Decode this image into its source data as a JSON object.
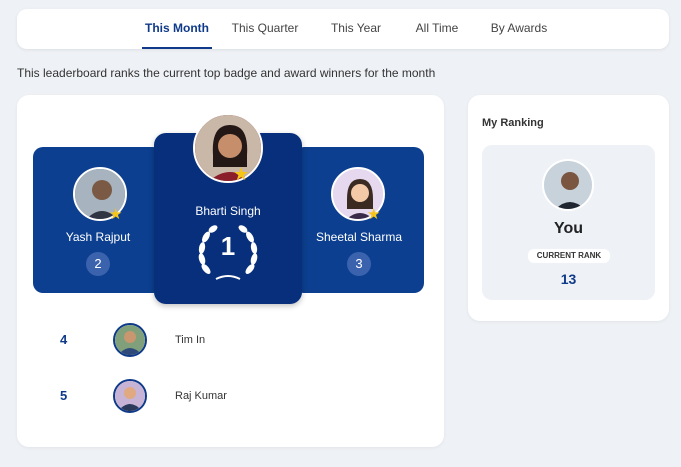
{
  "tabs": [
    {
      "label": "This Month",
      "active": true
    },
    {
      "label": "This Quarter",
      "active": false
    },
    {
      "label": "This Year",
      "active": false
    },
    {
      "label": "All Time",
      "active": false
    },
    {
      "label": "By Awards",
      "active": false
    }
  ],
  "description": "This leaderboard ranks the current top badge and award winners for the month",
  "podium": {
    "first": {
      "name": "Bharti Singh",
      "rank": "1"
    },
    "second": {
      "name": "Yash Rajput",
      "rank": "2"
    },
    "third": {
      "name": "Sheetal Sharma",
      "rank": "3"
    }
  },
  "list": [
    {
      "rank": "4",
      "name": "Tim In"
    },
    {
      "rank": "5",
      "name": "Raj Kumar"
    }
  ],
  "my_ranking": {
    "title": "My Ranking",
    "you_label": "You",
    "badge_label": "CURRENT RANK",
    "rank": "13"
  },
  "colors": {
    "accent": "#0f3a8a",
    "podium_side": "#0c3f8f",
    "podium_center": "#072f7c",
    "star": "#f5c518",
    "background": "#eef1f5"
  },
  "icons": {
    "star": "star-icon",
    "laurel": "laurel-wreath-icon"
  }
}
